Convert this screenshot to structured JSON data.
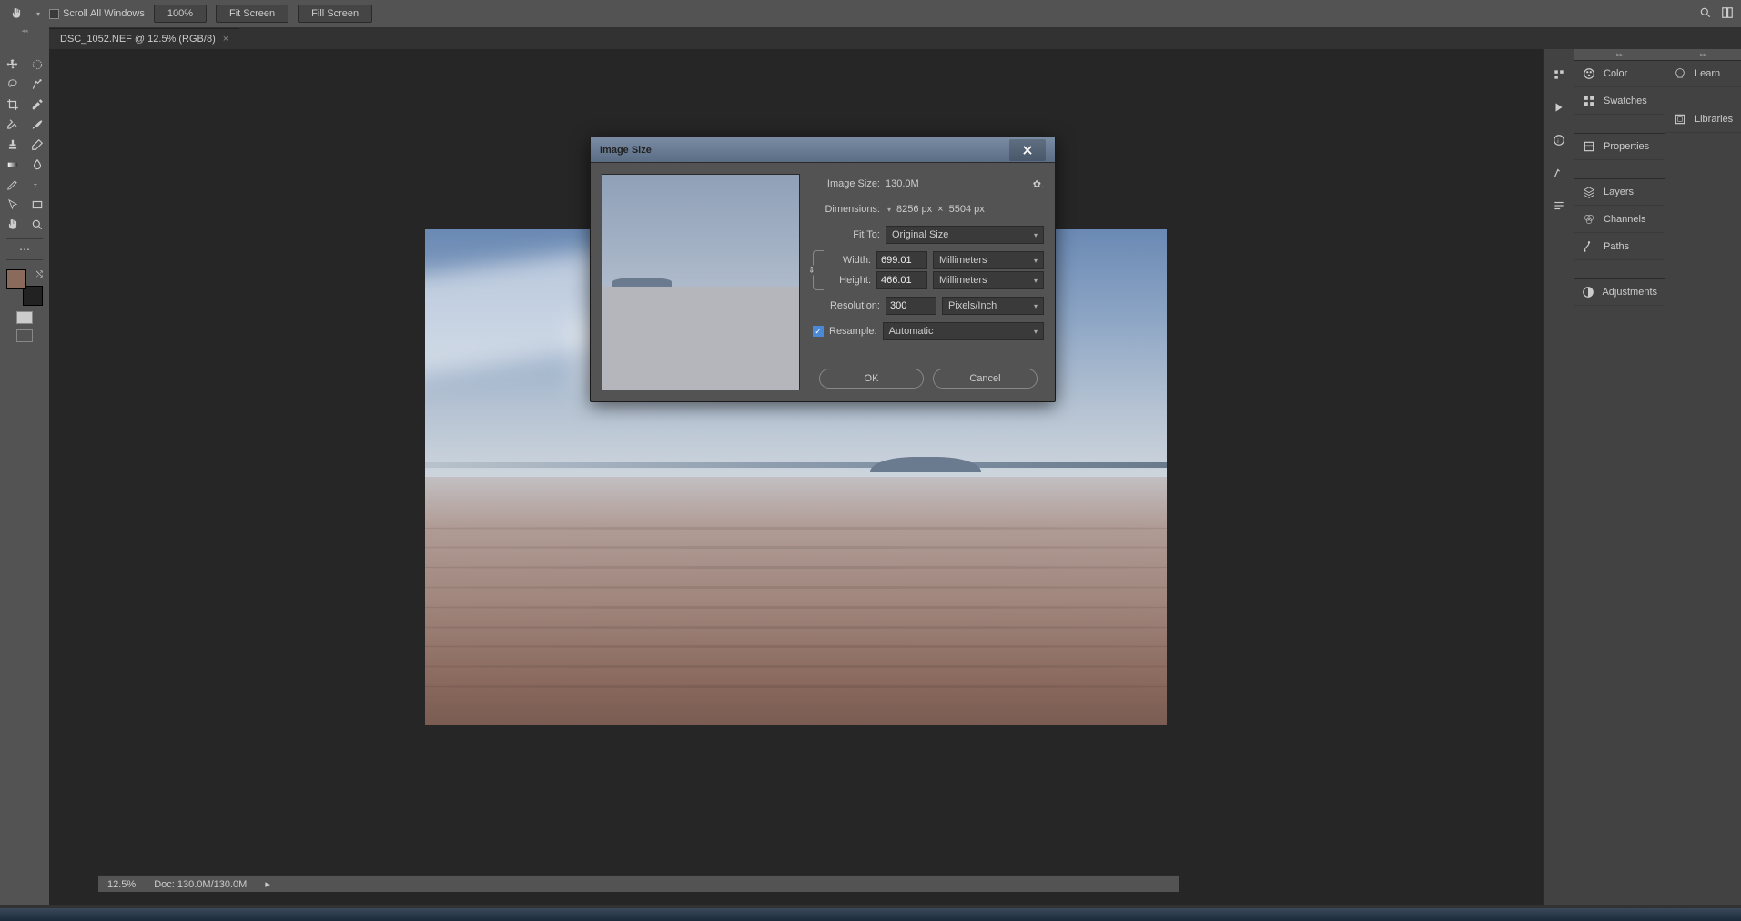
{
  "options_bar": {
    "scroll_all_windows": "Scroll All Windows",
    "zoom_100": "100%",
    "fit_screen": "Fit Screen",
    "fill_screen": "Fill Screen"
  },
  "document_tab": {
    "title": "DSC_1052.NEF @ 12.5% (RGB/8)"
  },
  "toolbar": {
    "fg_color": "#8a6a5a",
    "bg_color": "#222222"
  },
  "right_panels": {
    "col1": [
      "Color",
      "Swatches",
      "Properties",
      "Layers",
      "Channels",
      "Paths",
      "Adjustments"
    ],
    "col2": [
      "Learn",
      "Libraries"
    ]
  },
  "status_bar": {
    "zoom": "12.5%",
    "doc": "Doc: 130.0M/130.0M"
  },
  "dialog": {
    "title": "Image Size",
    "image_size_label": "Image Size:",
    "image_size_value": "130.0M",
    "dimensions_label": "Dimensions:",
    "dimensions_value_w": "8256 px",
    "dimensions_times": "×",
    "dimensions_value_h": "5504 px",
    "fit_to_label": "Fit To:",
    "fit_to_value": "Original Size",
    "width_label": "Width:",
    "width_value": "699.01",
    "width_unit": "Millimeters",
    "height_label": "Height:",
    "height_value": "466.01",
    "height_unit": "Millimeters",
    "resolution_label": "Resolution:",
    "resolution_value": "300",
    "resolution_unit": "Pixels/Inch",
    "resample_label": "Resample:",
    "resample_value": "Automatic",
    "ok": "OK",
    "cancel": "Cancel"
  }
}
